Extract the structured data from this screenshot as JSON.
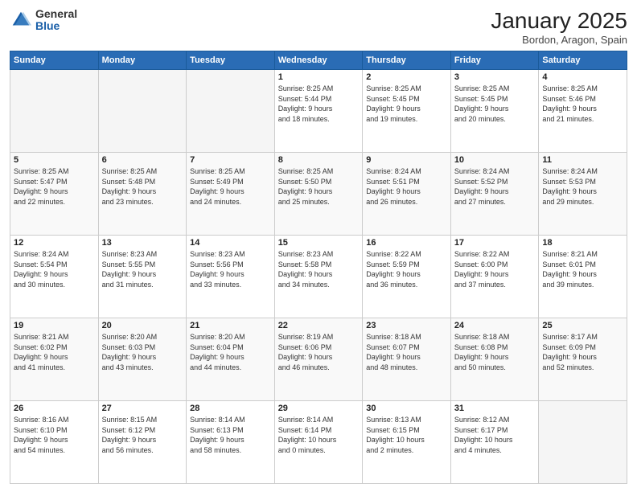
{
  "header": {
    "logo_general": "General",
    "logo_blue": "Blue",
    "title": "January 2025",
    "subtitle": "Bordon, Aragon, Spain"
  },
  "days_of_week": [
    "Sunday",
    "Monday",
    "Tuesday",
    "Wednesday",
    "Thursday",
    "Friday",
    "Saturday"
  ],
  "weeks": [
    {
      "days": [
        {
          "num": "",
          "info": ""
        },
        {
          "num": "",
          "info": ""
        },
        {
          "num": "",
          "info": ""
        },
        {
          "num": "1",
          "info": "Sunrise: 8:25 AM\nSunset: 5:44 PM\nDaylight: 9 hours\nand 18 minutes."
        },
        {
          "num": "2",
          "info": "Sunrise: 8:25 AM\nSunset: 5:45 PM\nDaylight: 9 hours\nand 19 minutes."
        },
        {
          "num": "3",
          "info": "Sunrise: 8:25 AM\nSunset: 5:45 PM\nDaylight: 9 hours\nand 20 minutes."
        },
        {
          "num": "4",
          "info": "Sunrise: 8:25 AM\nSunset: 5:46 PM\nDaylight: 9 hours\nand 21 minutes."
        }
      ]
    },
    {
      "days": [
        {
          "num": "5",
          "info": "Sunrise: 8:25 AM\nSunset: 5:47 PM\nDaylight: 9 hours\nand 22 minutes."
        },
        {
          "num": "6",
          "info": "Sunrise: 8:25 AM\nSunset: 5:48 PM\nDaylight: 9 hours\nand 23 minutes."
        },
        {
          "num": "7",
          "info": "Sunrise: 8:25 AM\nSunset: 5:49 PM\nDaylight: 9 hours\nand 24 minutes."
        },
        {
          "num": "8",
          "info": "Sunrise: 8:25 AM\nSunset: 5:50 PM\nDaylight: 9 hours\nand 25 minutes."
        },
        {
          "num": "9",
          "info": "Sunrise: 8:24 AM\nSunset: 5:51 PM\nDaylight: 9 hours\nand 26 minutes."
        },
        {
          "num": "10",
          "info": "Sunrise: 8:24 AM\nSunset: 5:52 PM\nDaylight: 9 hours\nand 27 minutes."
        },
        {
          "num": "11",
          "info": "Sunrise: 8:24 AM\nSunset: 5:53 PM\nDaylight: 9 hours\nand 29 minutes."
        }
      ]
    },
    {
      "days": [
        {
          "num": "12",
          "info": "Sunrise: 8:24 AM\nSunset: 5:54 PM\nDaylight: 9 hours\nand 30 minutes."
        },
        {
          "num": "13",
          "info": "Sunrise: 8:23 AM\nSunset: 5:55 PM\nDaylight: 9 hours\nand 31 minutes."
        },
        {
          "num": "14",
          "info": "Sunrise: 8:23 AM\nSunset: 5:56 PM\nDaylight: 9 hours\nand 33 minutes."
        },
        {
          "num": "15",
          "info": "Sunrise: 8:23 AM\nSunset: 5:58 PM\nDaylight: 9 hours\nand 34 minutes."
        },
        {
          "num": "16",
          "info": "Sunrise: 8:22 AM\nSunset: 5:59 PM\nDaylight: 9 hours\nand 36 minutes."
        },
        {
          "num": "17",
          "info": "Sunrise: 8:22 AM\nSunset: 6:00 PM\nDaylight: 9 hours\nand 37 minutes."
        },
        {
          "num": "18",
          "info": "Sunrise: 8:21 AM\nSunset: 6:01 PM\nDaylight: 9 hours\nand 39 minutes."
        }
      ]
    },
    {
      "days": [
        {
          "num": "19",
          "info": "Sunrise: 8:21 AM\nSunset: 6:02 PM\nDaylight: 9 hours\nand 41 minutes."
        },
        {
          "num": "20",
          "info": "Sunrise: 8:20 AM\nSunset: 6:03 PM\nDaylight: 9 hours\nand 43 minutes."
        },
        {
          "num": "21",
          "info": "Sunrise: 8:20 AM\nSunset: 6:04 PM\nDaylight: 9 hours\nand 44 minutes."
        },
        {
          "num": "22",
          "info": "Sunrise: 8:19 AM\nSunset: 6:06 PM\nDaylight: 9 hours\nand 46 minutes."
        },
        {
          "num": "23",
          "info": "Sunrise: 8:18 AM\nSunset: 6:07 PM\nDaylight: 9 hours\nand 48 minutes."
        },
        {
          "num": "24",
          "info": "Sunrise: 8:18 AM\nSunset: 6:08 PM\nDaylight: 9 hours\nand 50 minutes."
        },
        {
          "num": "25",
          "info": "Sunrise: 8:17 AM\nSunset: 6:09 PM\nDaylight: 9 hours\nand 52 minutes."
        }
      ]
    },
    {
      "days": [
        {
          "num": "26",
          "info": "Sunrise: 8:16 AM\nSunset: 6:10 PM\nDaylight: 9 hours\nand 54 minutes."
        },
        {
          "num": "27",
          "info": "Sunrise: 8:15 AM\nSunset: 6:12 PM\nDaylight: 9 hours\nand 56 minutes."
        },
        {
          "num": "28",
          "info": "Sunrise: 8:14 AM\nSunset: 6:13 PM\nDaylight: 9 hours\nand 58 minutes."
        },
        {
          "num": "29",
          "info": "Sunrise: 8:14 AM\nSunset: 6:14 PM\nDaylight: 10 hours\nand 0 minutes."
        },
        {
          "num": "30",
          "info": "Sunrise: 8:13 AM\nSunset: 6:15 PM\nDaylight: 10 hours\nand 2 minutes."
        },
        {
          "num": "31",
          "info": "Sunrise: 8:12 AM\nSunset: 6:17 PM\nDaylight: 10 hours\nand 4 minutes."
        },
        {
          "num": "",
          "info": ""
        }
      ]
    }
  ]
}
